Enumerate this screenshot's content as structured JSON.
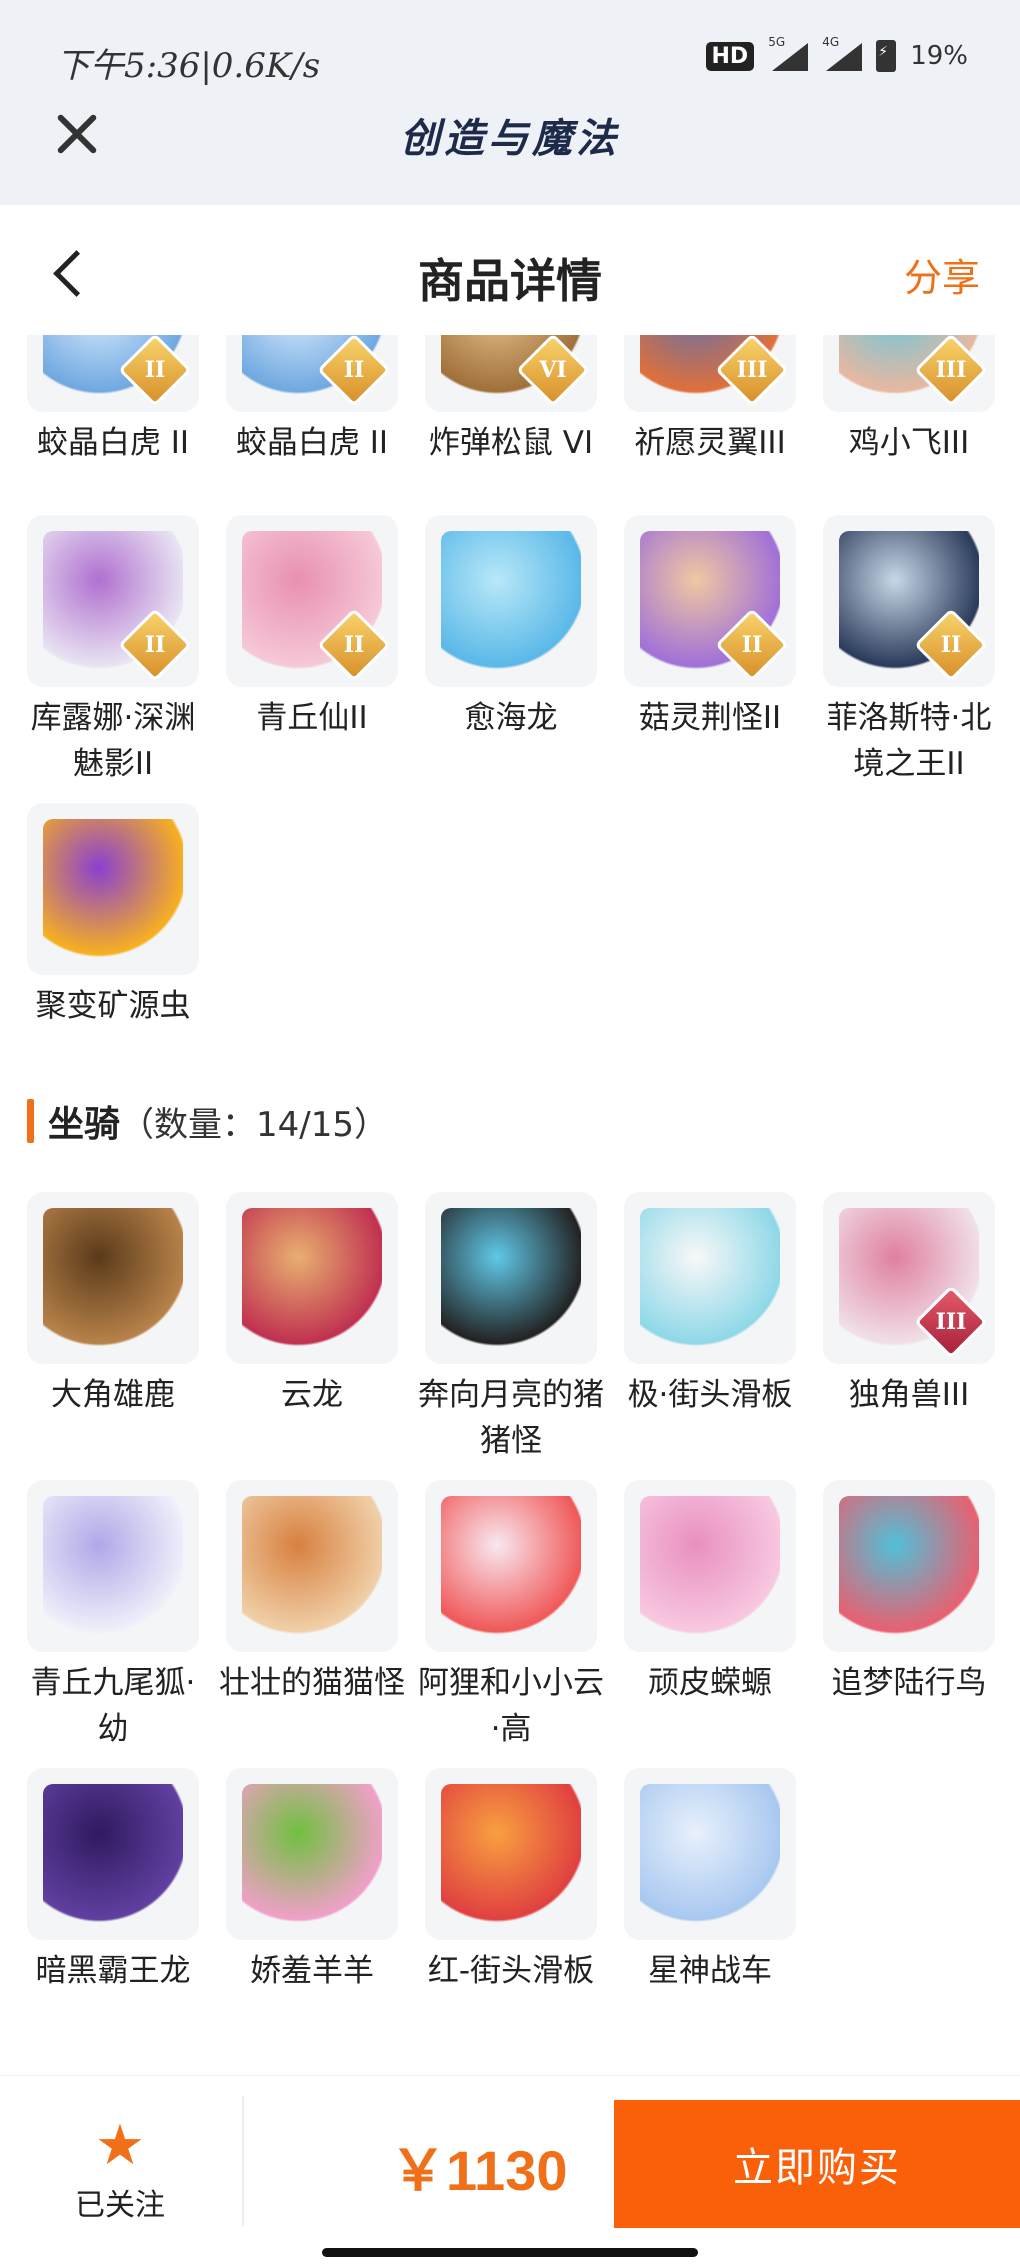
{
  "status": {
    "time": "下午5:36|0.6K/s",
    "hd": "HD",
    "net1": "5G",
    "net2": "4G",
    "battery": "19%"
  },
  "app": {
    "title": "创造与魔法",
    "close_icon": "close-icon"
  },
  "nav": {
    "title": "商品详情",
    "share": "分享",
    "back_icon": "chevron-left-icon"
  },
  "pets_partial": [
    {
      "label": "蛟晶白虎 II",
      "rank": "II",
      "rank_color": "gold",
      "colors": [
        "#6fa8e0",
        "#dfeeff"
      ]
    },
    {
      "label": "蛟晶白虎 II",
      "rank": "II",
      "rank_color": "gold",
      "colors": [
        "#6fa8e0",
        "#dfeeff"
      ]
    },
    {
      "label": "炸弹松鼠 VI",
      "rank": "VI",
      "rank_color": "gold",
      "colors": [
        "#a0703a",
        "#e8c690"
      ]
    },
    {
      "label": "祈愿灵翼III",
      "rank": "III",
      "rank_color": "gold",
      "colors": [
        "#e0703a",
        "#5a70b0"
      ]
    },
    {
      "label": "鸡小飞III",
      "rank": "III",
      "rank_color": "gold",
      "colors": [
        "#e8b8a0",
        "#60c8e0"
      ]
    }
  ],
  "pets": [
    {
      "label": "库露娜·深渊魅影II",
      "rank": "II",
      "rank_color": "gold",
      "colors": [
        "#e9e4f2",
        "#b070d0"
      ]
    },
    {
      "label": "青丘仙II",
      "rank": "II",
      "rank_color": "gold",
      "colors": [
        "#f6c8d8",
        "#e890b0"
      ]
    },
    {
      "label": "愈海龙",
      "rank": "",
      "rank_color": "",
      "colors": [
        "#5ab8e8",
        "#b8e8f8"
      ]
    },
    {
      "label": "菇灵荆怪II",
      "rank": "II",
      "rank_color": "gold",
      "colors": [
        "#a070d8",
        "#f0c8a0"
      ]
    },
    {
      "label": "菲洛斯特·北境之王II",
      "rank": "II",
      "rank_color": "gold",
      "colors": [
        "#2a3a5a",
        "#c8d8e8"
      ]
    },
    {
      "label": "聚变矿源虫",
      "rank": "",
      "rank_color": "",
      "colors": [
        "#f8b020",
        "#8a40d0"
      ]
    }
  ],
  "mounts_section": {
    "title": "坐骑",
    "count": "（数量：14/15）"
  },
  "mounts": [
    {
      "label": "大角雄鹿",
      "rank": "",
      "rank_color": "",
      "colors": [
        "#b8824a",
        "#5a3a1a"
      ]
    },
    {
      "label": "云龙",
      "rank": "",
      "rank_color": "",
      "colors": [
        "#c03050",
        "#e8b070"
      ]
    },
    {
      "label": "奔向月亮的猪猪怪",
      "rank": "",
      "rank_color": "",
      "colors": [
        "#222222",
        "#60c8e8"
      ]
    },
    {
      "label": "极·街头滑板",
      "rank": "",
      "rank_color": "",
      "colors": [
        "#8ed8e8",
        "#f8f8f8"
      ]
    },
    {
      "label": "独角兽III",
      "rank": "III",
      "rank_color": "red",
      "colors": [
        "#f0e0e8",
        "#e080a0"
      ]
    },
    {
      "label": "青丘九尾狐·幼",
      "rank": "",
      "rank_color": "",
      "colors": [
        "#eef0fa",
        "#b0a8e8"
      ]
    },
    {
      "label": "壮壮的猫猫怪",
      "rank": "",
      "rank_color": "",
      "colors": [
        "#f0d0a8",
        "#d88040"
      ]
    },
    {
      "label": "阿狸和小小云·高",
      "rank": "",
      "rank_color": "",
      "colors": [
        "#f05858",
        "#f8e8f0"
      ]
    },
    {
      "label": "顽皮蝾螈",
      "rank": "",
      "rank_color": "",
      "colors": [
        "#f8c8e0",
        "#e890c0"
      ]
    },
    {
      "label": "追梦陆行鸟",
      "rank": "",
      "rank_color": "",
      "colors": [
        "#e86070",
        "#50c0d8"
      ]
    },
    {
      "label": "暗黑霸王龙",
      "rank": "",
      "rank_color": "",
      "colors": [
        "#6040a0",
        "#301a60"
      ]
    },
    {
      "label": "娇羞羊羊",
      "rank": "",
      "rank_color": "",
      "colors": [
        "#f0a0c8",
        "#70c040"
      ]
    },
    {
      "label": "红-街头滑板",
      "rank": "",
      "rank_color": "",
      "colors": [
        "#e04040",
        "#f8a040"
      ]
    },
    {
      "label": "星神战车",
      "rank": "",
      "rank_color": "",
      "colors": [
        "#a8c8f0",
        "#e8f0fc"
      ]
    }
  ],
  "bottom": {
    "follow_label": "已关注",
    "follow_icon": "star-icon",
    "price": "￥1130",
    "buy_label": "立即购买"
  },
  "theme": {
    "accent": "#f0701a",
    "buy_button": "#fa5f0a"
  }
}
